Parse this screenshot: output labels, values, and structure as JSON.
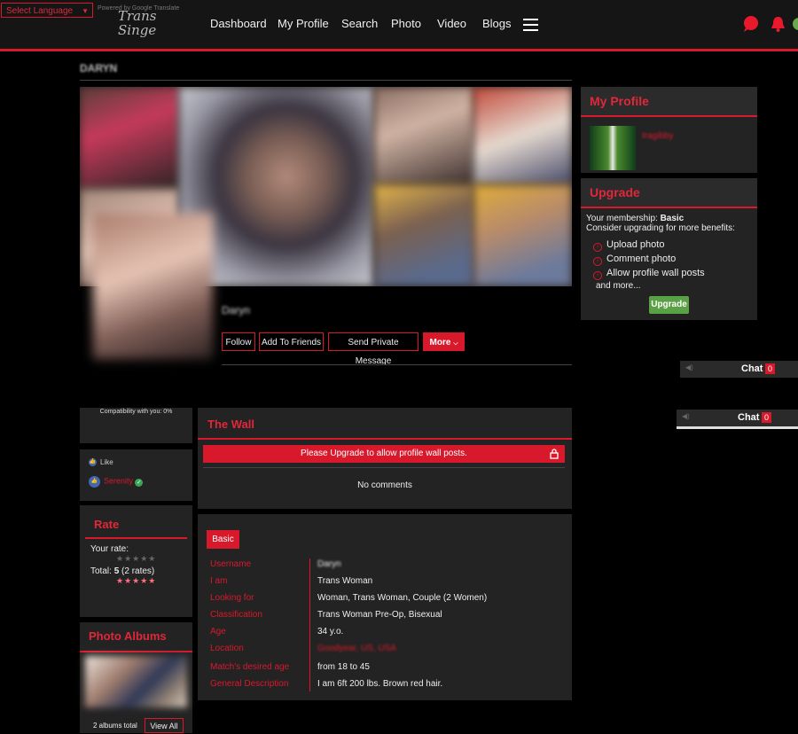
{
  "topbar": {
    "language_select": "Select Language",
    "powered_by": "Powered by Google Translate",
    "logo_text": "Trans Singe",
    "nav": [
      "Dashboard",
      "My Profile",
      "Search",
      "Photo",
      "Video",
      "Blogs"
    ]
  },
  "profile": {
    "page_title": "DARYN",
    "display_name": "Daryn",
    "buttons": {
      "follow": "Follow",
      "add_friends": "Add To Friends",
      "send_message": "Send Private Message",
      "more": "More"
    },
    "compatibility": "Compatibility with you: 0%"
  },
  "sidebar": {
    "my_profile": {
      "title": "My Profile",
      "username": "Iragibby"
    },
    "upgrade": {
      "title": "Upgrade",
      "membership_label": "Your membership:",
      "membership_value": "Basic",
      "consider": "Consider upgrading for more benefits:",
      "benefits": [
        "Upload photo",
        "Comment photo",
        "Allow profile wall posts"
      ],
      "more": "and more...",
      "button": "Upgrade"
    }
  },
  "chat": {
    "label": "Chat",
    "count": "0"
  },
  "likes": {
    "label": "Like",
    "user": "Serenity"
  },
  "rate": {
    "title": "Rate",
    "your_rate_label": "Your rate:",
    "total_label": "Total:",
    "total_value": "5",
    "rates_text": "(2 rates)",
    "your_stars": 0,
    "total_stars": 5
  },
  "albums": {
    "title": "Photo Albums",
    "total": "2 albums total",
    "view_all": "View All"
  },
  "wall": {
    "title": "The Wall",
    "alert": "Please Upgrade to allow profile wall posts.",
    "empty": "No comments"
  },
  "basic": {
    "tab": "Basic",
    "rows": [
      {
        "key": "Username",
        "value": "Daryn"
      },
      {
        "key": "I am",
        "value": "Trans Woman"
      },
      {
        "key": "Looking for",
        "value": "Woman, Trans Woman, Couple (2 Women)"
      },
      {
        "key": "Classification",
        "value": "Trans Woman Pre-Op, Bisexual"
      },
      {
        "key": "Age",
        "value": "34 y.o."
      },
      {
        "key": "Location",
        "value": "Goodyear, US, USA"
      },
      {
        "key": "Match's desired age",
        "value": "from 18 to 45"
      },
      {
        "key": "General Description",
        "value": "I am 6ft 200 lbs. Brown red hair."
      }
    ]
  },
  "colors": {
    "accent": "#d8192c",
    "panel": "#232323",
    "upgrade_button": "#5aa044"
  }
}
